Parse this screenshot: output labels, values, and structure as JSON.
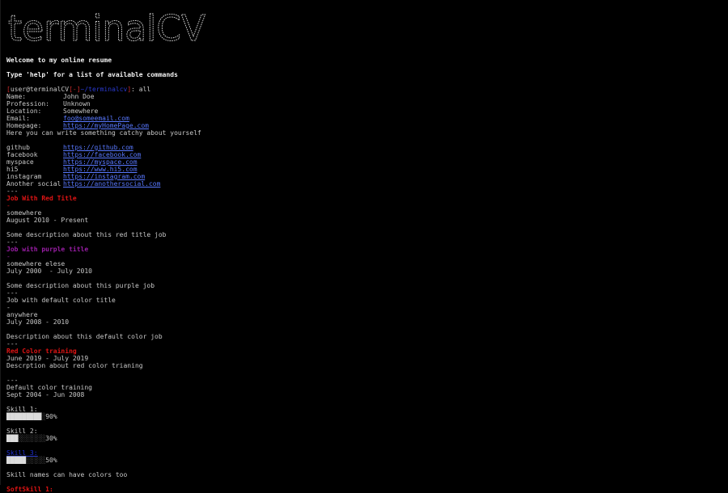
{
  "logo_text": "terminalCV",
  "welcome": "Welcome to my online resume",
  "help_hint": "Type 'help' for a list of available commands",
  "prompt": {
    "open": "[",
    "user": "user@terminalCV",
    "dash": "[-]",
    "path": "~/terminalcv",
    "close": "]",
    "suffix": ": all"
  },
  "info": {
    "name_key": "Name:",
    "name": "John Doe",
    "profession_key": "Profession:",
    "profession": "Unknown",
    "location_key": "Location:",
    "location": "Somewhere",
    "email_key": "Email:",
    "email": "foo@someemail.com",
    "homepage_key": "Homepage:",
    "homepage": "https://myHomePage.com",
    "about": "Here you can write something catchy about yourself"
  },
  "socials": [
    {
      "name": "github",
      "url": "https://github.com"
    },
    {
      "name": "facebook",
      "url": "https://facebook.com"
    },
    {
      "name": "myspace",
      "url": "https://myspace.com"
    },
    {
      "name": "hi5",
      "url": "https://www.hi5.com"
    },
    {
      "name": "instagram",
      "url": "https://instagram.com"
    },
    {
      "name": "Another social",
      "url": "https://anothersocial.com"
    }
  ],
  "separator": "---",
  "dash": "-",
  "jobs": [
    {
      "title": "Job With Red Title",
      "color": "#e01414",
      "dash": "-",
      "place": "somewhere",
      "dates": "August 2010 - Present",
      "desc": "Some description about this red title job"
    },
    {
      "title": "Job with purple title",
      "color": "#9a1ea6",
      "dash": "-",
      "place": "somewhere elese",
      "dates": "July 2000  - July 2010",
      "desc": "Some description about this purple job"
    },
    {
      "title": "Job with default color title",
      "color": "#c8c8c8",
      "dash": "-",
      "place": "anywhere",
      "dates": "July 2008 - 2010",
      "desc": "Description about this default color job"
    }
  ],
  "trainings": [
    {
      "title": "Red Color training",
      "color": "#e01414",
      "dates": "June 2019 - July 2019",
      "desc": "Descrption about red color trianing"
    },
    {
      "title": "Default color training",
      "color": "#c8c8c8",
      "dates": "Sept 2004 - Jun 2008"
    }
  ],
  "skills": [
    {
      "label": "Skill 1:",
      "percent": 90,
      "percent_text": "90%",
      "filled": "█████████",
      "empty": "░",
      "color": "#c8c8c8"
    },
    {
      "label": "Skill 2:",
      "percent": 30,
      "percent_text": "30%",
      "filled": "███",
      "empty": "░░░░░░░",
      "color": "#c8c8c8"
    },
    {
      "label": "Skill 3:",
      "percent": 50,
      "percent_text": "50%",
      "filled": "█████",
      "empty": "░░░░░",
      "color": "#1e2fd6"
    }
  ],
  "skills_note": "Skill names can have colors too",
  "softskill_label": "SoftSkill 1:"
}
